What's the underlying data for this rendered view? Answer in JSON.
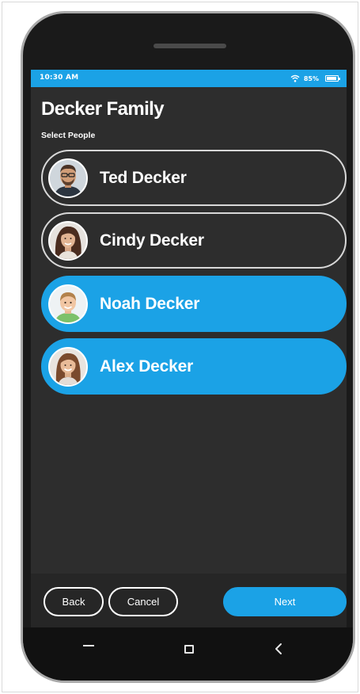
{
  "status_bar": {
    "time": "10:30 AM",
    "battery": "85%",
    "icons": [
      "wifi-icon",
      "battery-icon"
    ]
  },
  "header": {
    "title": "Decker Family",
    "subtitle": "Select People"
  },
  "people": [
    {
      "name": "Ted Decker",
      "selected": false,
      "avatar": "adult-man-avatar"
    },
    {
      "name": "Cindy Decker",
      "selected": false,
      "avatar": "adult-woman-avatar"
    },
    {
      "name": "Noah Decker",
      "selected": true,
      "avatar": "boy-avatar"
    },
    {
      "name": "Alex Decker",
      "selected": true,
      "avatar": "girl-avatar"
    }
  ],
  "actions": {
    "back_label": "Back",
    "cancel_label": "Cancel",
    "next_label": "Next"
  },
  "nav_bar": {
    "icons": [
      "recent-apps-icon",
      "home-icon",
      "back-icon"
    ]
  },
  "colors": {
    "accent": "#1ba2e6",
    "screen_bg": "#2d2d2d",
    "text": "#ffffff"
  }
}
